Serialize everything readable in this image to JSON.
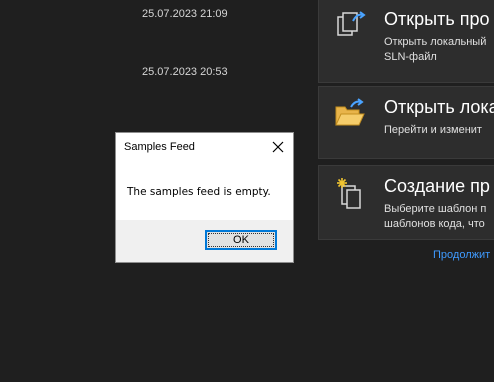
{
  "recent": [
    {
      "timestamp": "25.07.2023 21:09"
    },
    {
      "timestamp": "25.07.2023 20:53"
    }
  ],
  "cards": [
    {
      "icon": "open-project-icon",
      "title": "Открыть про",
      "desc_line1": "Открыть локальный",
      "desc_line2": "SLN-файл"
    },
    {
      "icon": "open-folder-icon",
      "title": "Открыть лока",
      "desc_line1": "Перейти и изменит",
      "desc_line2": ""
    },
    {
      "icon": "new-project-icon",
      "title": "Создание пр",
      "desc_line1": "Выберите шаблон п",
      "desc_line2": "шаблонов кода, что"
    }
  ],
  "continue_link": "Продолжит",
  "dialog": {
    "title": "Samples Feed",
    "message": "The samples feed is empty.",
    "ok_label": "OK"
  },
  "colors": {
    "background": "#1f1f1f",
    "card": "#2d2d2d",
    "link": "#3f9bff",
    "accent": "#0078d7"
  }
}
